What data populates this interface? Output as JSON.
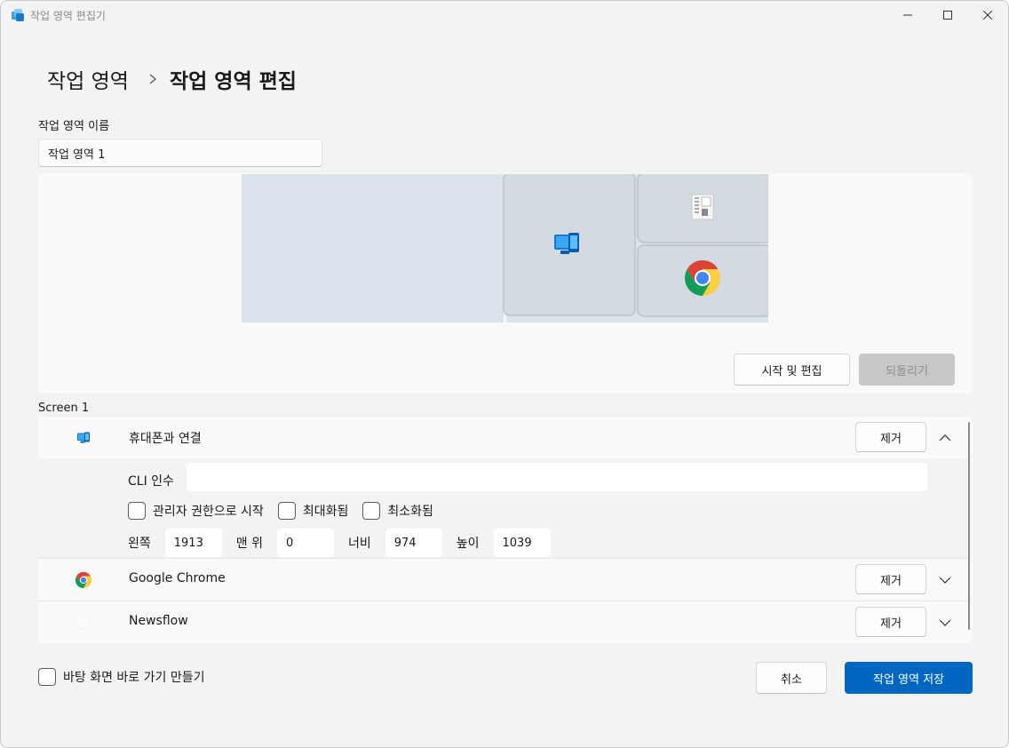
{
  "window": {
    "title": "작업 영역 편집기",
    "icon": "workspaces-app-icon"
  },
  "breadcrumb": {
    "parent": "작업 영역",
    "current": "작업 영역 편집"
  },
  "workspace_name": {
    "label": "작업 영역 이름",
    "value": "작업 영역 1"
  },
  "preview": {
    "launch_edit_label": "시작 및 편집",
    "revert_label": "되돌리기"
  },
  "screen_label": "Screen 1",
  "apps": [
    {
      "name": "휴대폰과 연결",
      "icon": "phone-link-icon",
      "remove_label": "제거",
      "expanded": true,
      "cli_label": "CLI 인수",
      "cli_value": "",
      "options": [
        {
          "label": "관리자 권한으로 시작",
          "checked": false
        },
        {
          "label": "최대화됨",
          "checked": false
        },
        {
          "label": "최소화됨",
          "checked": false
        }
      ],
      "position": {
        "left_label": "왼쪽",
        "left_value": "1913",
        "top_label": "맨 위",
        "top_value": "0",
        "width_label": "너비",
        "width_value": "974",
        "height_label": "높이",
        "height_value": "1039"
      }
    },
    {
      "name": "Google Chrome",
      "icon": "chrome-icon",
      "remove_label": "제거",
      "expanded": false
    },
    {
      "name": "Newsflow",
      "icon": "newsflow-icon",
      "remove_label": "제거",
      "expanded": false
    }
  ],
  "footer": {
    "shortcut_label": "바탕 화면 바로 가기 만들기",
    "shortcut_checked": false,
    "cancel_label": "취소",
    "save_label": "작업 영역 저장"
  },
  "colors": {
    "accent": "#0067c0",
    "zone_fill": "#dae3ec",
    "tile_fill": "#d3dae1"
  }
}
